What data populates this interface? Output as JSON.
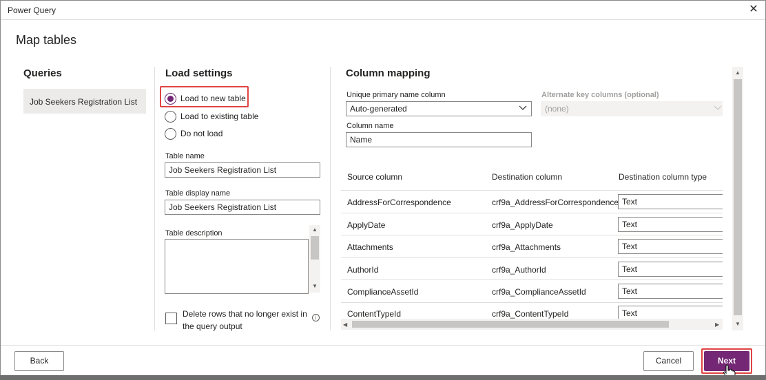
{
  "window": {
    "title": "Power Query",
    "close_icon": "close-icon"
  },
  "page": {
    "title": "Map tables"
  },
  "queries": {
    "heading": "Queries",
    "items": [
      "Job Seekers Registration List"
    ]
  },
  "load_settings": {
    "heading": "Load settings",
    "options": [
      {
        "label": "Load to new table",
        "checked": true
      },
      {
        "label": "Load to existing table",
        "checked": false
      },
      {
        "label": "Do not load",
        "checked": false
      }
    ],
    "table_name_label": "Table name",
    "table_name_value": "Job Seekers Registration List",
    "table_display_name_label": "Table display name",
    "table_display_name_value": "Job Seekers Registration List",
    "table_description_label": "Table description",
    "table_description_value": "",
    "delete_rows_label": "Delete rows that no longer exist in the query output",
    "delete_rows_checked": false,
    "info_icon": "info-icon"
  },
  "column_mapping": {
    "heading": "Column mapping",
    "primary_name_label": "Unique primary name column",
    "primary_name_value": "Auto-generated",
    "alternate_key_label": "Alternate key columns (optional)",
    "alternate_key_value": "(none)",
    "column_name_label": "Column name",
    "column_name_value": "Name",
    "columns": [
      "Source column",
      "Destination column",
      "Destination column type"
    ],
    "rows": [
      {
        "source": "AddressForCorrespondence",
        "destination": "crf9a_AddressForCorrespondence",
        "type": "Text"
      },
      {
        "source": "ApplyDate",
        "destination": "crf9a_ApplyDate",
        "type": "Text"
      },
      {
        "source": "Attachments",
        "destination": "crf9a_Attachments",
        "type": "Text"
      },
      {
        "source": "AuthorId",
        "destination": "crf9a_AuthorId",
        "type": "Text"
      },
      {
        "source": "ComplianceAssetId",
        "destination": "crf9a_ComplianceAssetId",
        "type": "Text"
      },
      {
        "source": "ContentTypeId",
        "destination": "crf9a_ContentTypeId",
        "type": "Text"
      }
    ]
  },
  "footer": {
    "back_label": "Back",
    "cancel_label": "Cancel",
    "next_label": "Next"
  },
  "colors": {
    "accent": "#742774",
    "highlight": "#e04343",
    "selected_bg": "#edebe9"
  }
}
